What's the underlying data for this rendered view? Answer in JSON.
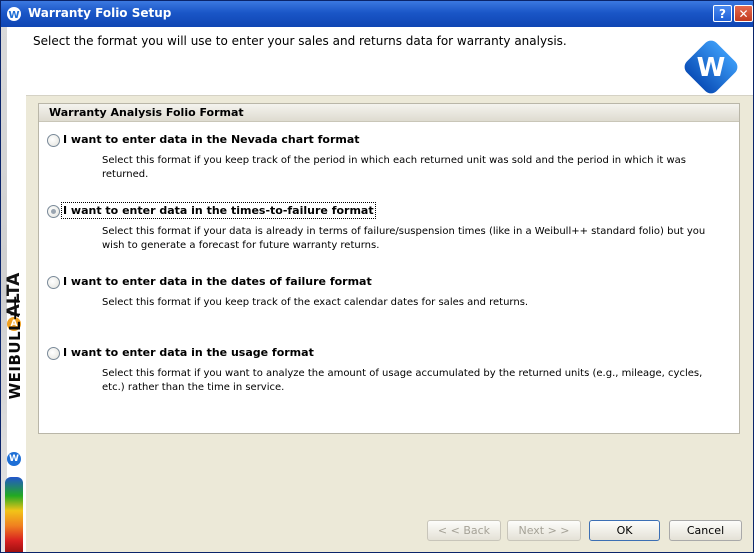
{
  "window": {
    "title": "Warranty Folio Setup",
    "help_label": "?",
    "close_label": "✕"
  },
  "sidebar": {
    "brand": "WEIBULL++",
    "alta": "ALTA",
    "w": "W",
    "a": "A"
  },
  "header": {
    "instruction": "Select the format you will use to enter your sales and returns data for warranty analysis.",
    "logo_letter": "W"
  },
  "group": {
    "title": "Warranty Analysis Folio Format",
    "options": [
      {
        "label": "I want to enter data in the Nevada chart format",
        "description": "Select this format if you keep track of the period in which each returned unit was sold and the period in which it was returned.",
        "selected": false
      },
      {
        "label": "I want to enter data in the times-to-failure format",
        "description": "Select this format if your data is already in terms of failure/suspension times (like in a Weibull++ standard folio) but you wish to generate a forecast for future warranty returns.",
        "selected": true
      },
      {
        "label": "I want to enter data in the dates of failure format",
        "description": "Select this format if you keep track of the exact calendar dates for sales and returns.",
        "selected": false
      },
      {
        "label": "I want to enter data in the usage format",
        "description": "Select this format if you want to analyze the amount of usage accumulated by the returned units (e.g., mileage, cycles, etc.) rather than the time in service.",
        "selected": false
      }
    ]
  },
  "buttons": {
    "back": "< < Back",
    "next": "Next > >",
    "ok": "OK",
    "cancel": "Cancel"
  },
  "colors": {
    "titlebar": "#1a56c7",
    "logo": "#1e6fd6"
  }
}
